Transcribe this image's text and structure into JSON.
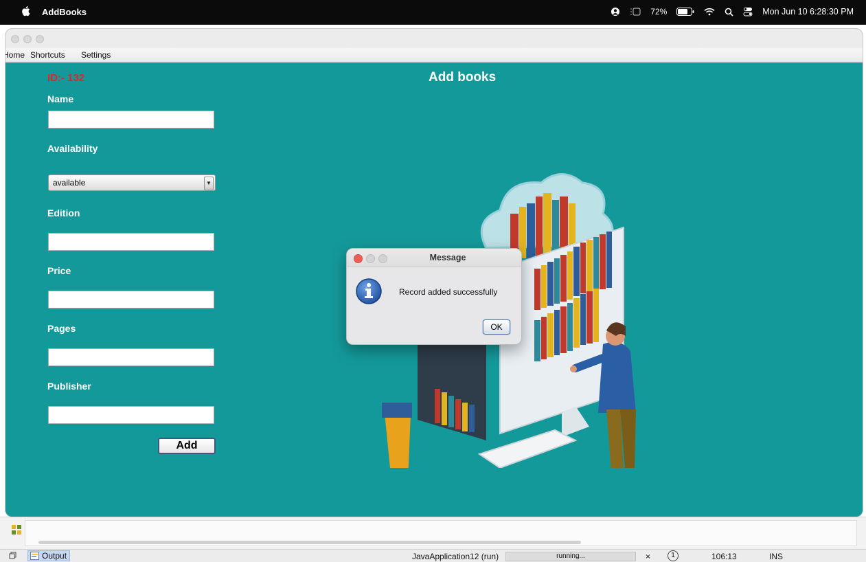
{
  "menubar": {
    "app_name": "AddBooks",
    "battery": "72%",
    "datetime": "Mon Jun 10  6:28:30 PM",
    "icons": [
      "apple-icon",
      "user-icon",
      "screen-mirror-icon",
      "battery-icon",
      "wifi-icon",
      "search-icon",
      "control-center-icon"
    ]
  },
  "window": {
    "menus": [
      "Home",
      "Shortcuts",
      "Settings"
    ]
  },
  "form": {
    "id_label": "ID:- 132",
    "heading": "Add books",
    "name_label": "Name",
    "name_value": "",
    "availability_label": "Availability",
    "availability_value": "available",
    "edition_label": "Edition",
    "edition_value": "",
    "price_label": "Price",
    "price_value": "",
    "pages_label": "Pages",
    "pages_value": "",
    "publisher_label": "Publisher",
    "publisher_value": "",
    "add_button": "Add"
  },
  "dialog": {
    "title": "Message",
    "message": "Record added successfully",
    "ok_button": "OK",
    "icon": "info-icon"
  },
  "statusbar": {
    "output_tab": "Output",
    "run_label": "JavaApplication12 (run)",
    "progress_text": "running...",
    "close": "×",
    "notifications": "1",
    "position": "106:13",
    "mode": "INS"
  },
  "colors": {
    "background": "#14999a",
    "id_label": "#e0242c",
    "menubar": "#0b0b0b"
  }
}
